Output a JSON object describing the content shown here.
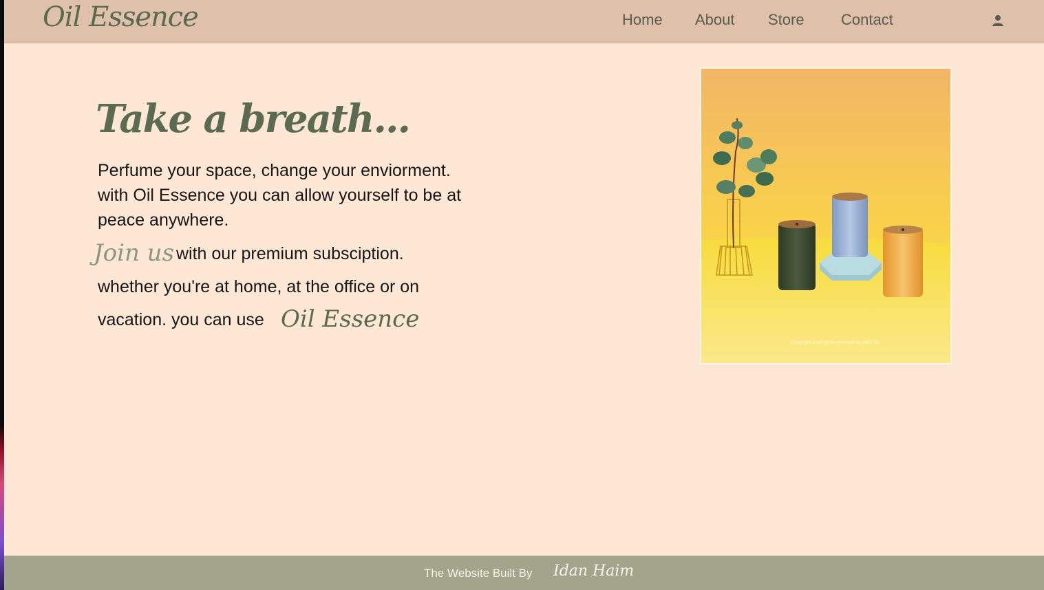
{
  "header": {
    "logo": "Oil Essence",
    "nav": [
      "Home",
      "About",
      "Store",
      "Contact"
    ],
    "user_icon": "user-icon"
  },
  "hero": {
    "title": "Take a breath...",
    "lines": [
      "Perfume your space, change your enviorment.",
      "with Oil Essence you can allow yourself to be at",
      "peace anywhere."
    ],
    "join_script": "Join us",
    "join_rest": "with our premium subsciption.",
    "line_home": "whether you're at home, at the office or on",
    "line_vacation": "vacation. you can use",
    "brand_script": "Oil Essence"
  },
  "product_image": {
    "watermark": "Copyright ©All rights reserved by MEETA"
  },
  "footer": {
    "built_by": "The Website Built By",
    "author": "Idan Haim"
  },
  "colors": {
    "page_bg": "#ffe7d6",
    "header_bg": "#dfc0ab",
    "footer_bg": "#a2a58b",
    "brand_green": "#5a6a4f"
  }
}
